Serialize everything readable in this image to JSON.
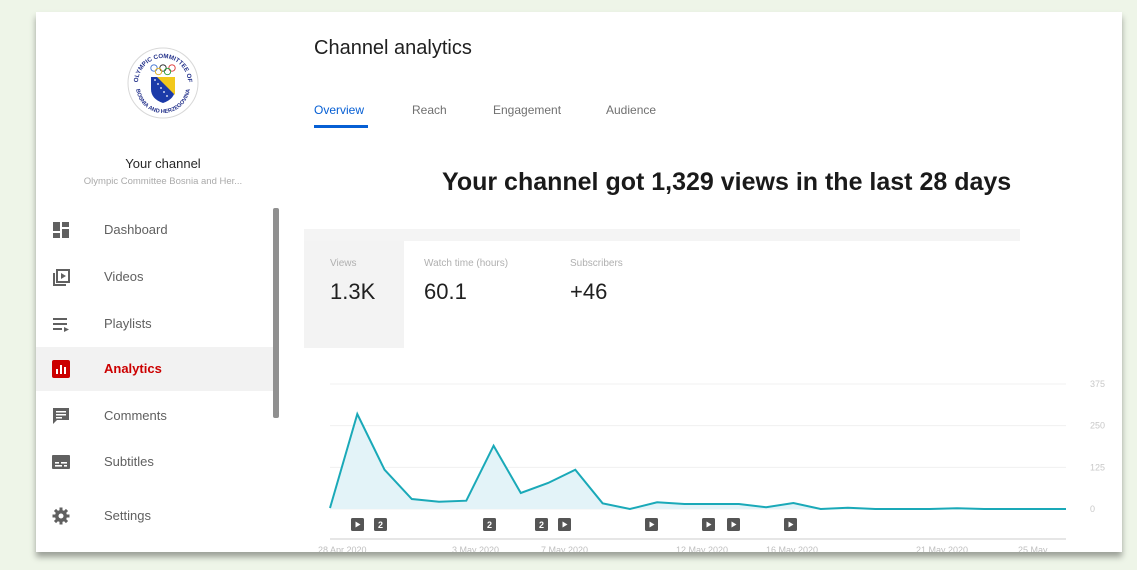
{
  "sidebar": {
    "channel_title": "Your channel",
    "channel_name": "Olympic Committee Bosnia and Her...",
    "logo_text_top": "OLYMPIC COMMITTEE OF",
    "logo_text_bottom": "BOSNIA AND HERZEGOVINA",
    "items": [
      {
        "label": "Dashboard",
        "icon": "dashboard-icon"
      },
      {
        "label": "Videos",
        "icon": "videos-icon"
      },
      {
        "label": "Playlists",
        "icon": "playlists-icon"
      },
      {
        "label": "Analytics",
        "icon": "analytics-icon",
        "active": true
      },
      {
        "label": "Comments",
        "icon": "comments-icon"
      },
      {
        "label": "Subtitles",
        "icon": "subtitles-icon"
      },
      {
        "label": "Settings",
        "icon": "settings-icon"
      }
    ]
  },
  "main": {
    "title": "Channel analytics",
    "tabs": [
      {
        "label": "Overview",
        "active": true
      },
      {
        "label": "Reach"
      },
      {
        "label": "Engagement"
      },
      {
        "label": "Audience"
      }
    ],
    "headline": "Your channel got 1,329 views in the last 28 days",
    "metrics": [
      {
        "label": "Views",
        "value": "1.3K"
      },
      {
        "label": "Watch time (hours)",
        "value": "60.1"
      },
      {
        "label": "Subscribers",
        "value": "+46"
      }
    ]
  },
  "colors": {
    "accent": "#065fd4",
    "active_nav": "#cc0000",
    "chart_line": "#1aa9b8",
    "chart_fill": "#e3f3f8"
  },
  "chart_data": {
    "type": "area",
    "x": [
      "28 Apr 2020",
      "29 Apr",
      "30 Apr",
      "1 May",
      "2 May",
      "3 May 2020",
      "4 May",
      "5 May",
      "6 May",
      "7 May 2020",
      "8 May",
      "9 May",
      "10 May",
      "11 May",
      "12 May 2020",
      "13 May",
      "14 May",
      "15 May",
      "16 May 2020",
      "17 May",
      "18 May",
      "19 May",
      "20 May",
      "21 May 2020",
      "22 May",
      "23 May",
      "24 May",
      "25 May"
    ],
    "values": [
      3,
      285,
      118,
      30,
      22,
      25,
      190,
      48,
      78,
      118,
      17,
      0,
      20,
      15,
      15,
      15,
      5,
      18,
      0,
      4,
      0,
      0,
      0,
      2,
      0,
      0,
      0,
      0
    ],
    "ylim": [
      0,
      375
    ],
    "y_ticks": [
      "375",
      "250",
      "125",
      "0"
    ],
    "x_tick_labels": [
      "28 Apr 2020",
      "3 May 2020",
      "7 May 2020",
      "12 May 2020",
      "16 May 2020",
      "21 May 2020",
      "25 May"
    ],
    "upload_markers": [
      {
        "type": "video"
      },
      {
        "type": "count",
        "count": "2"
      },
      {
        "type": "count",
        "count": "2"
      },
      {
        "type": "count",
        "count": "2"
      },
      {
        "type": "video"
      },
      {
        "type": "video"
      },
      {
        "type": "video"
      },
      {
        "type": "video"
      },
      {
        "type": "video"
      }
    ],
    "grid": true
  }
}
